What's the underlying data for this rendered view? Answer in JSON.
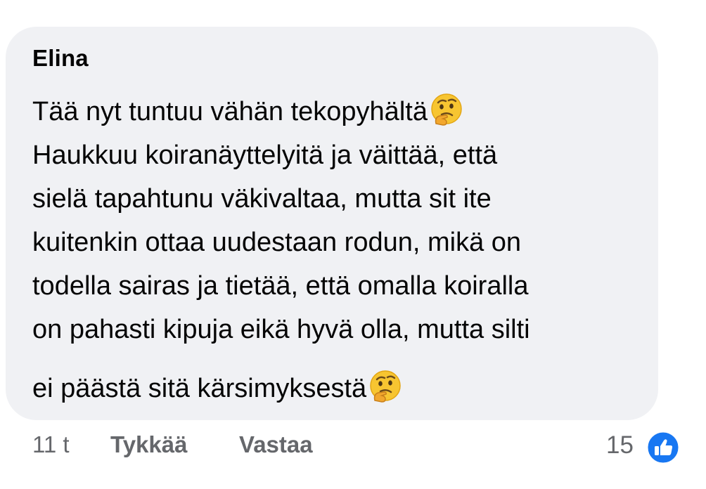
{
  "comment": {
    "author": "Elina",
    "lines": [
      "Tää nyt tuntuu vähän tekopyhältä",
      "Haukkuu koiranäyttelyitä ja väittää, että",
      "sielä tapahtunu väkivaltaa, mutta sit ite",
      "kuitenkin ottaa uudestaan rodun, mikä on",
      "todella sairas ja tietää, että omalla koiralla",
      "on pahasti kipuja eikä hyvä olla, mutta silti",
      "ei päästä sitä kärsimyksestä"
    ],
    "emoji": "thinking-face-icon"
  },
  "actions": {
    "time": "11 t",
    "like_label": "Tykkää",
    "reply_label": "Vastaa",
    "reaction_count": "15",
    "reaction_icon": "like-thumb-icon"
  },
  "colors": {
    "bubble_bg": "#f0f1f4",
    "text": "#050505",
    "secondary_text": "#65676b",
    "like_blue": "#1877f2"
  }
}
